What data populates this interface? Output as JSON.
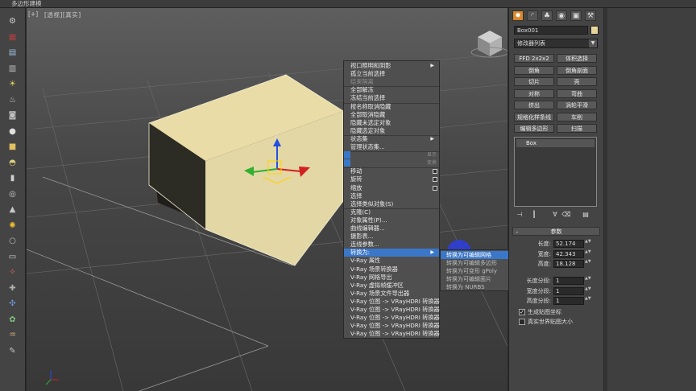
{
  "title": "多边形建模",
  "viewport": {
    "label_plus": "[+]",
    "label": "[透视][真实]"
  },
  "left_toolbar": {
    "icons": [
      "render-setup-icon",
      "material-editor-icon",
      "render-frame-icon",
      "schematic-icon",
      "light-bulb-icon",
      "teapot-icon",
      "camera-icon",
      "sphere-icon",
      "box-icon",
      "dome-icon",
      "cylinder-icon",
      "torus-icon",
      "cone-icon",
      "sun-icon",
      "sphere-small-icon",
      "plane-icon",
      "particle-icon",
      "helper-icon",
      "warp-icon",
      "gear-icon",
      "hair-icon",
      "brush-icon"
    ]
  },
  "context_menu": {
    "items": [
      {
        "label": "视口照明和阴影",
        "disabled": false,
        "arrow": true
      },
      {
        "label": "孤立当前选择",
        "disabled": false
      },
      {
        "label": "结束隔离",
        "disabled": true
      },
      {
        "label": "全部解冻",
        "disabled": false
      },
      {
        "label": "冻结当前选择",
        "disabled": false
      },
      {
        "label": "按名称取消隐藏",
        "disabled": false
      },
      {
        "label": "全部取消隐藏",
        "disabled": false
      },
      {
        "label": "隐藏未选定对象",
        "disabled": false
      },
      {
        "label": "隐藏选定对象",
        "disabled": false
      },
      {
        "label": "状态集",
        "disabled": false,
        "arrow": true
      },
      {
        "label": "管理状态集...",
        "disabled": false
      },
      {
        "label": "显示",
        "disabled": true,
        "section": true
      },
      {
        "label": "变换",
        "disabled": true,
        "section": true
      },
      {
        "label": "移动",
        "disabled": false,
        "box": true
      },
      {
        "label": "旋转",
        "disabled": false,
        "box": true
      },
      {
        "label": "缩放",
        "disabled": false,
        "box": true
      },
      {
        "label": "选择",
        "disabled": false
      },
      {
        "label": "选择类似对象(S)",
        "disabled": false
      },
      {
        "label": "克隆(C)",
        "disabled": false
      },
      {
        "label": "对象属性(P)...",
        "disabled": false
      },
      {
        "label": "曲线编辑器...",
        "disabled": false
      },
      {
        "label": "摄影表...",
        "disabled": false
      },
      {
        "label": "连线参数...",
        "disabled": false
      },
      {
        "label": "转换为:",
        "disabled": false,
        "arrow": true,
        "highlight": true
      },
      {
        "label": "V-Ray 属性",
        "disabled": false
      },
      {
        "label": "V-Ray 场景转换器",
        "disabled": false
      },
      {
        "label": "V-Ray 网格导出",
        "disabled": false
      },
      {
        "label": "V-Ray 虚拟帧缓冲区",
        "disabled": false
      },
      {
        "label": "V-Ray 场景文件导出器",
        "disabled": false
      },
      {
        "label": "V-Ray 位图 -> VRayHDRI 转换器",
        "disabled": false
      },
      {
        "label": "V-Ray 位图 -> VRayHDRI 转换器",
        "disabled": false
      },
      {
        "label": "V-Ray 位图 -> VRayHDRI 转换器",
        "disabled": false
      },
      {
        "label": "V-Ray 位图 -> VRayHDRI 转换器",
        "disabled": false
      },
      {
        "label": "V-Ray 位图 -> VRayHDRI 转换器",
        "disabled": false
      }
    ]
  },
  "submenu": {
    "items": [
      {
        "label": "转换为可编辑网格",
        "highlight": true
      },
      {
        "label": "转换为可编辑多边形",
        "highlight": false
      },
      {
        "label": "转换为可变形 gPoly",
        "highlight": false
      },
      {
        "label": "转换为可编辑面片",
        "highlight": false
      },
      {
        "label": "转换为 NURBS",
        "highlight": false
      }
    ]
  },
  "command_panel": {
    "object_name": "Box001",
    "modifier_list": "修改器列表",
    "modifier_buttons": [
      [
        "FFD 2x2x2",
        "体积选择"
      ],
      [
        "倒角",
        "倒角剖面"
      ],
      [
        "切片",
        "壳"
      ],
      [
        "对称",
        "弯曲"
      ],
      [
        "挤出",
        "涡轮平滑"
      ],
      [
        "规格化样条线",
        "车削"
      ],
      [
        "编辑多边形",
        "扫描"
      ]
    ],
    "stack": [
      "Box"
    ],
    "params_header": "参数",
    "params": [
      {
        "label": "长度:",
        "value": "52.174"
      },
      {
        "label": "宽度:",
        "value": "42.343"
      },
      {
        "label": "高度:",
        "value": "18.128"
      }
    ],
    "segments": [
      {
        "label": "长度分段:",
        "value": "1"
      },
      {
        "label": "宽度分段:",
        "value": "1"
      },
      {
        "label": "高度分段:",
        "value": "1"
      }
    ],
    "checkboxes": [
      {
        "label": "生成贴图坐标",
        "checked": true
      },
      {
        "label": "真实世界贴图大小",
        "checked": false
      }
    ]
  },
  "axis": {
    "z": "z"
  },
  "colors": {
    "box_top": "#e9dca7",
    "highlight": "#3a77c9",
    "active_tab": "#d8872a"
  }
}
